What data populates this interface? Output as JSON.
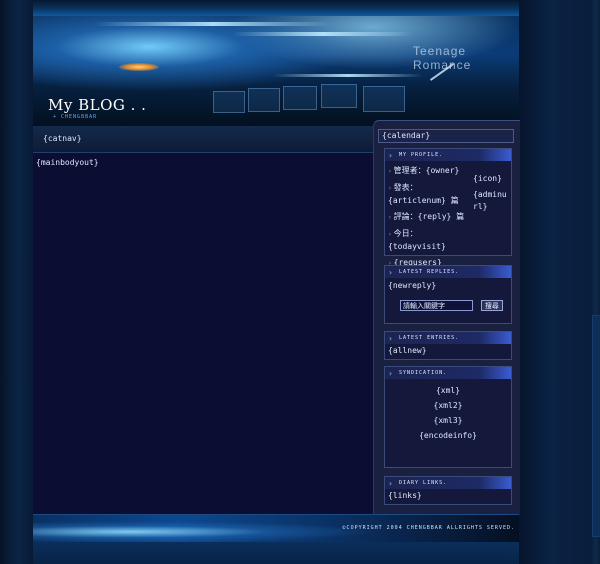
{
  "header": {
    "title": "My BLOG . .",
    "subtitle": "+ CHENGBBAR",
    "tagline": "Teenage Romance"
  },
  "nav": {
    "catnav": "{catnav}"
  },
  "main": {
    "body": "{mainbodyout}"
  },
  "sidebar": {
    "calendar": "{calendar}",
    "profile": {
      "heading": "MY PROFILE.",
      "items": [
        "管理者：{owner}",
        "發表：{articlenum} 篇",
        "評論：{reply} 篇",
        "今日：{todayvisit}",
        "{regusers} {current online}"
      ],
      "icon": "{icon}",
      "admin": "{adminurl}"
    },
    "replies": {
      "heading": "LATEST REPLIES.",
      "text": "{newreply}",
      "search_placeholder": "請輸入關鍵字",
      "search_button": "搜尋"
    },
    "entries": {
      "heading": "LATEST ENTRIES.",
      "text": "{allnew}"
    },
    "syndication": {
      "heading": "SYNDICATION.",
      "items": [
        "{xml}",
        "{xml2}",
        "{xml3}",
        "{encodeinfo}"
      ]
    },
    "links": {
      "heading": "DIARY LINKS.",
      "text": "{links}"
    }
  },
  "footer": {
    "copyright": "©COPYRIGHT 2004 CHENGBBAR ALLRIGHTS SERVED."
  },
  "colors": {
    "accent": "#3a5cd0",
    "background": "#0c0d33",
    "sidebar": "#1a2040"
  }
}
